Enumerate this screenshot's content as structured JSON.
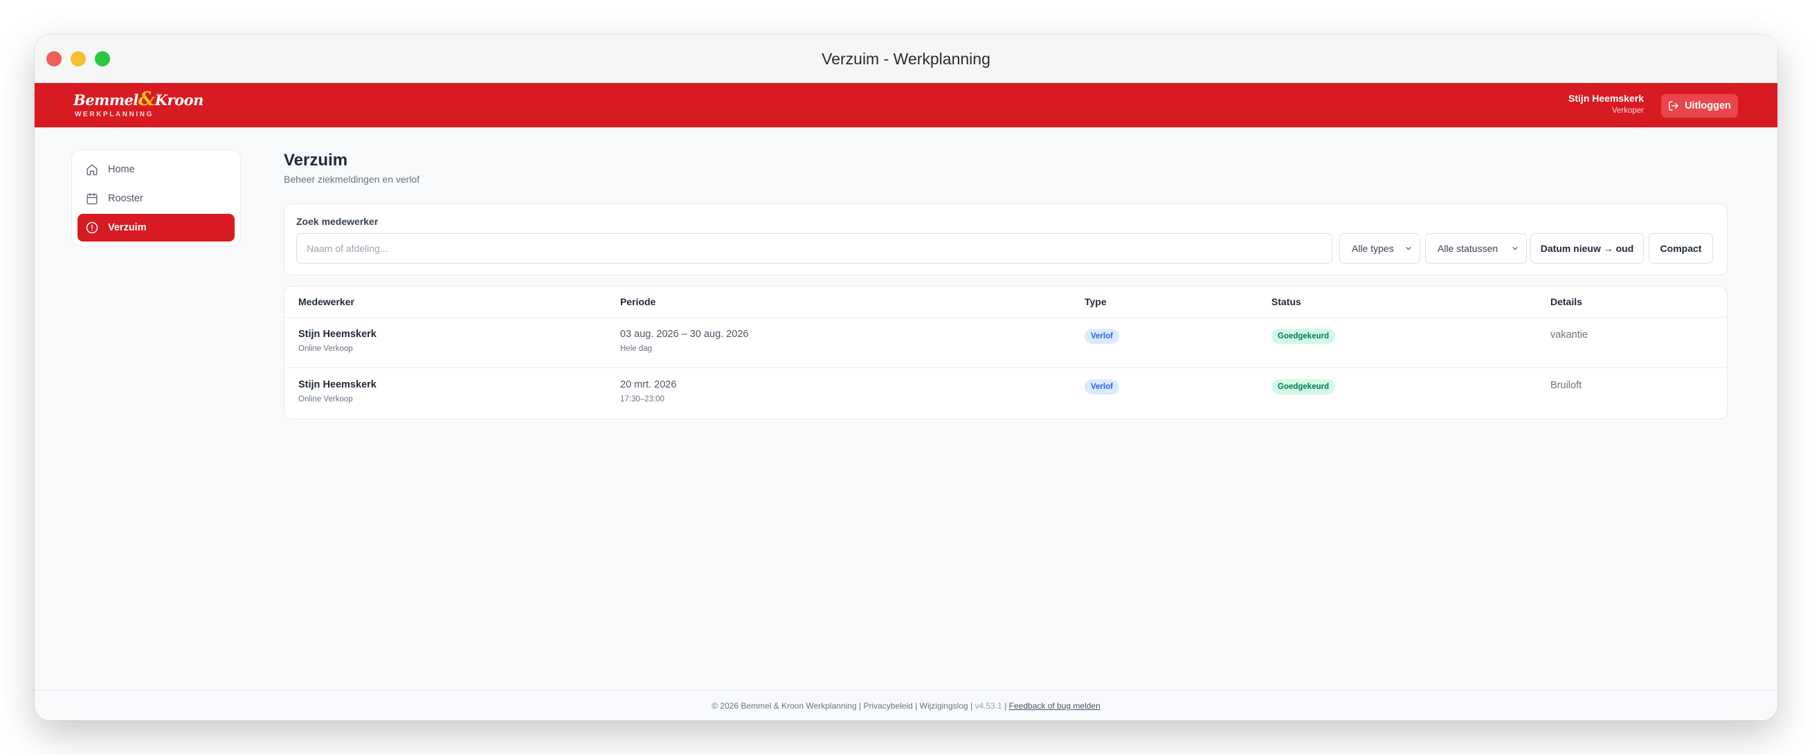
{
  "window": {
    "title": "Verzuim - Werkplanning"
  },
  "header": {
    "logo": {
      "text_left": "Bemmel",
      "amp": "&",
      "text_right": "Kroon",
      "sub": "WERKPLANNING"
    },
    "user_name": "Stijn Heemskerk",
    "user_role": "Verkoper",
    "logout_label": "Uitloggen",
    "brand_color": "#d81b22"
  },
  "sidebar": {
    "items": [
      {
        "label": "Home",
        "icon": "home-icon",
        "active": false
      },
      {
        "label": "Rooster",
        "icon": "calendar-icon",
        "active": false
      },
      {
        "label": "Verzuim",
        "icon": "alert-circle-icon",
        "active": true
      }
    ]
  },
  "main": {
    "title": "Verzuim",
    "subtitle": "Beheer ziekmeldingen en verlof",
    "filters": {
      "search_label": "Zoek medewerker",
      "search_placeholder": "Naam of afdeling...",
      "search_value": "",
      "type_select": "Alle types",
      "status_select": "Alle statussen",
      "sort_button": "Datum nieuw → oud",
      "compact_button": "Compact"
    },
    "table": {
      "columns": [
        "Medewerker",
        "Periode",
        "Type",
        "Status",
        "Details"
      ],
      "rows": [
        {
          "name": "Stijn Heemskerk",
          "department": "Online Verkoop",
          "period": "03 aug. 2026 – 30 aug. 2026",
          "period_sub": "Hele dag",
          "type": "Verlof",
          "status": "Goedgekeurd",
          "details": "vakantie"
        },
        {
          "name": "Stijn Heemskerk",
          "department": "Online Verkoop",
          "period": "20 mrt. 2026",
          "period_sub": "17:30–23:00",
          "type": "Verlof",
          "status": "Goedgekeurd",
          "details": "Bruiloft"
        }
      ]
    }
  },
  "footer": {
    "copyright": "© 2026 Bemmel & Kroon Werkplanning",
    "sep": "|",
    "privacy": "Privacybeleid",
    "changelog": "Wijzigingslog",
    "version": "v4.53.1",
    "feedback": "Feedback of bug melden"
  }
}
